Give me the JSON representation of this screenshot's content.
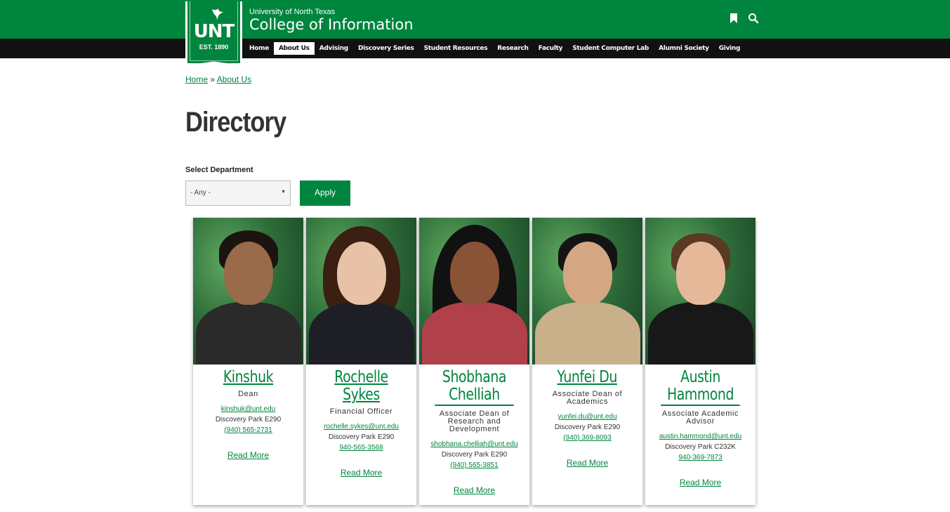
{
  "header": {
    "university": "University of North Texas",
    "college": "College of Information",
    "logo_text": "UNT",
    "logo_est": "EST. 1890",
    "icons": [
      "bookmark-icon",
      "search-icon"
    ]
  },
  "nav": {
    "items": [
      "Home",
      "About Us",
      "Advising",
      "Discovery Series",
      "Student Resources",
      "Research",
      "Faculty",
      "Student Computer Lab",
      "Alumni Society",
      "Giving"
    ],
    "active": "About Us"
  },
  "breadcrumb": {
    "home": "Home",
    "separator": "»",
    "current": "About Us"
  },
  "page_title": "Directory",
  "filter": {
    "label": "Select Department",
    "selected": "- Any -",
    "apply": "Apply"
  },
  "people": [
    {
      "name": "Kinshuk",
      "title": "Dean",
      "email": "kinshuk@unt.edu",
      "location": "Discovery Park E290",
      "phone": "(940) 565-2731",
      "read_more": "Read More"
    },
    {
      "name": "Rochelle Sykes",
      "title": "Financial Officer",
      "email": "rochelle.sykes@unt.edu",
      "location": "Discovery Park E290",
      "phone": "940-565-3568",
      "read_more": "Read More"
    },
    {
      "name": "Shobhana Chelliah",
      "title": "Associate Dean of Research and Development",
      "email": "shobhana.chelliah@unt.edu",
      "location": "Discovery Park E290",
      "phone": "(940) 565-3851",
      "read_more": "Read More"
    },
    {
      "name": "Yunfei Du",
      "title": "Associate Dean of Academics",
      "email": "yunfei.du@unt.edu",
      "location": "Discovery Park E290",
      "phone": "(940) 369-8093",
      "read_more": "Read More"
    },
    {
      "name": "Austin Hammond",
      "title": "Associate Academic Advisor",
      "email": "austin.hammond@unt.edu",
      "location": "Discovery Park C232K",
      "phone": "940-369-7873",
      "read_more": "Read More"
    }
  ],
  "colors": {
    "brand_green": "#00853e",
    "nav_black": "#111111"
  }
}
